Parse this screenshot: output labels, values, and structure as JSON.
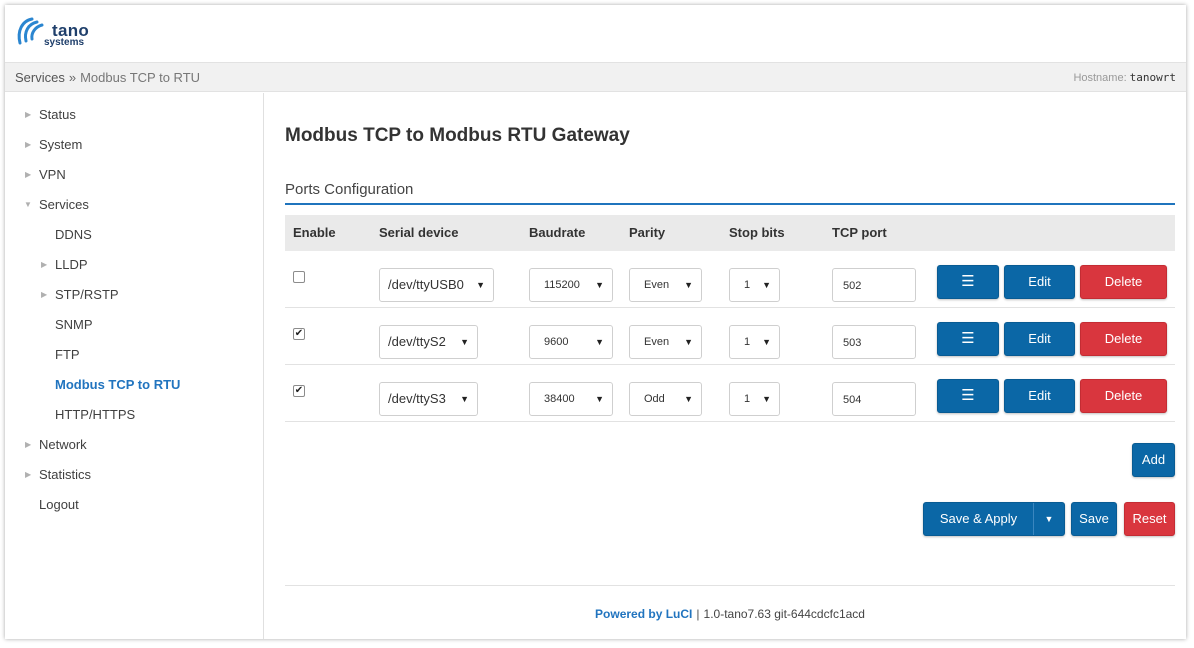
{
  "brand": {
    "line1": "tano",
    "line2": "systems"
  },
  "breadcrumb": {
    "parent": "Services",
    "separator": "»",
    "current": "Modbus TCP to RTU"
  },
  "hostname": {
    "label": "Hostname:",
    "value": "tanowrt"
  },
  "sidebar": {
    "items": [
      {
        "label": "Status"
      },
      {
        "label": "System"
      },
      {
        "label": "VPN"
      },
      {
        "label": "Services"
      },
      {
        "label": "DDNS"
      },
      {
        "label": "LLDP"
      },
      {
        "label": "STP/RSTP"
      },
      {
        "label": "SNMP"
      },
      {
        "label": "FTP"
      },
      {
        "label": "Modbus TCP to RTU"
      },
      {
        "label": "HTTP/HTTPS"
      },
      {
        "label": "Network"
      },
      {
        "label": "Statistics"
      },
      {
        "label": "Logout"
      }
    ]
  },
  "main": {
    "title": "Modbus TCP to Modbus RTU Gateway",
    "section_title": "Ports Configuration",
    "columns": [
      "Enable",
      "Serial device",
      "Baudrate",
      "Parity",
      "Stop bits",
      "TCP port"
    ],
    "rows": [
      {
        "enabled": false,
        "device": "/dev/ttyUSB0",
        "baud": "115200",
        "parity": "Even",
        "stop": "1",
        "port": "502"
      },
      {
        "enabled": true,
        "device": "/dev/ttyS2",
        "baud": "9600",
        "parity": "Even",
        "stop": "1",
        "port": "503"
      },
      {
        "enabled": true,
        "device": "/dev/ttyS3",
        "baud": "38400",
        "parity": "Odd",
        "stop": "1",
        "port": "504"
      }
    ],
    "row_buttons": {
      "menu_glyph": "☰",
      "edit": "Edit",
      "delete": "Delete"
    },
    "add_label": "Add",
    "actions": {
      "save_apply": "Save & Apply",
      "save": "Save",
      "reset": "Reset"
    }
  },
  "footer": {
    "powered": "Powered by LuCI",
    "separator": "|",
    "version": "1.0-tano7.63 git-644cdcfc1acd"
  },
  "colors": {
    "accent": "#0b67a6",
    "danger": "#d9363e",
    "link": "#2174bf"
  },
  "icons": {
    "collapsed": "chevron-right-icon",
    "expanded": "chevron-down-icon",
    "dropdown": "caret-down-icon",
    "menu": "hamburger-icon"
  }
}
